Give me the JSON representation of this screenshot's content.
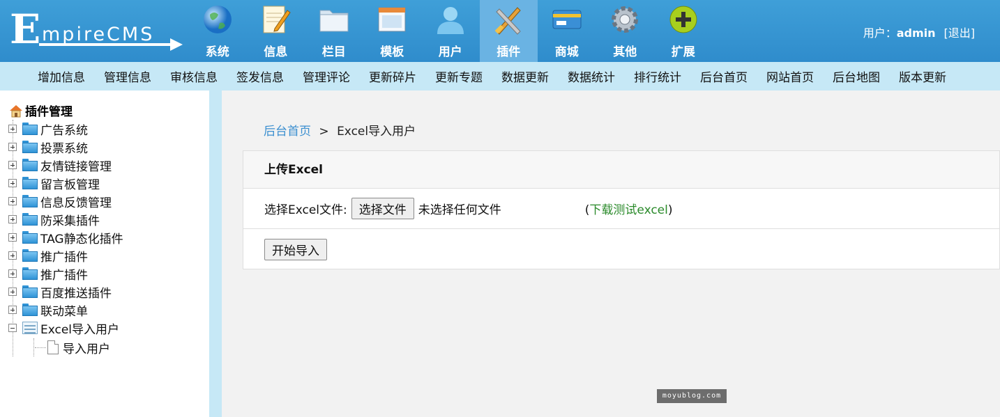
{
  "header": {
    "logo_text": "mpireCMS",
    "logo_initial": "E",
    "nav": [
      {
        "label": "系统",
        "icon": "globe-icon"
      },
      {
        "label": "信息",
        "icon": "notepad-pencil-icon"
      },
      {
        "label": "栏目",
        "icon": "folder-icon"
      },
      {
        "label": "模板",
        "icon": "window-icon"
      },
      {
        "label": "用户",
        "icon": "user-icon"
      },
      {
        "label": "插件",
        "icon": "tools-icon",
        "active": true
      },
      {
        "label": "商城",
        "icon": "card-icon"
      },
      {
        "label": "其他",
        "icon": "gear-icon"
      },
      {
        "label": "扩展",
        "icon": "plus-circle-icon"
      }
    ],
    "user_label": "用户：",
    "username": "admin",
    "logout": "[退出]"
  },
  "sub_nav": [
    "增加信息",
    "管理信息",
    "审核信息",
    "签发信息",
    "管理评论",
    "更新碎片",
    "更新专题",
    "数据更新",
    "数据统计",
    "排行统计",
    "后台首页",
    "网站首页",
    "后台地图",
    "版本更新"
  ],
  "sidebar": {
    "root": "插件管理",
    "items": [
      "广告系统",
      "投票系统",
      "友情链接管理",
      "留言板管理",
      "信息反馈管理",
      "防采集插件",
      "TAG静态化插件",
      "推广插件",
      "推广插件",
      "百度推送插件",
      "联动菜单",
      "Excel导入用户"
    ],
    "child": "导入用户"
  },
  "content": {
    "breadcrumb_home": "后台首页",
    "breadcrumb_sep": ">",
    "breadcrumb_current": "Excel导入用户",
    "panel_title": "上传Excel",
    "file_label": "选择Excel文件:",
    "file_button": "选择文件",
    "no_file": "未选择任何文件",
    "download_open": "(",
    "download_link": "下载测试excel",
    "download_close": ")",
    "start_button": "开始导入"
  },
  "watermark": "moyublog.com",
  "colors": {
    "header_blue": "#3d9ed6",
    "subnav_bg": "#c6e8f6",
    "link_blue": "#3b8fd0",
    "link_green": "#2a8a2a"
  }
}
